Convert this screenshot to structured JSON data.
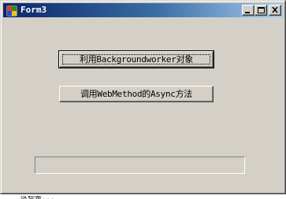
{
  "window": {
    "title": "Form3",
    "icon": "app-icon",
    "controls": {
      "minimize": "minimize-icon",
      "maximize": "maximize-icon",
      "close": "close-icon"
    }
  },
  "main": {
    "button_background_worker": "利用Backgroundworker对象",
    "button_webmethod_async": "调用WebMethod的Async方法",
    "progress": {
      "value": 0,
      "max": 100
    }
  },
  "colors": {
    "titlebar_start": "#0a246a",
    "titlebar_end": "#a6caf0",
    "face": "#d4d0c8",
    "progress_fill": "#0a246a"
  },
  "below_text": "这些是..."
}
